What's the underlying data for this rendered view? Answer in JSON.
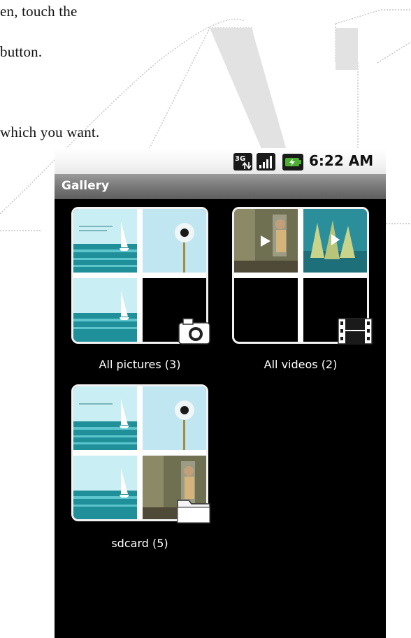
{
  "document": {
    "line_1": "en, touch the",
    "line_2": " button.",
    "line_3": "which you want."
  },
  "status_bar": {
    "network_icon": "3g-data-icon",
    "signal_icon": "signal-strength-icon",
    "battery_icon": "battery-charging-icon",
    "time": "6:22 AM"
  },
  "app": {
    "title": "Gallery"
  },
  "albums": [
    {
      "label": "All pictures (3)",
      "type_icon": "camera-icon"
    },
    {
      "label": "All videos (2)",
      "type_icon": "film-icon"
    },
    {
      "label": "sdcard (5)",
      "type_icon": "folder-icon"
    }
  ],
  "colors": {
    "screen_background": "#000000",
    "title_bar": "#7c7c7c",
    "status_bar": "#f4f4f4",
    "label_text": "#ffffff"
  }
}
